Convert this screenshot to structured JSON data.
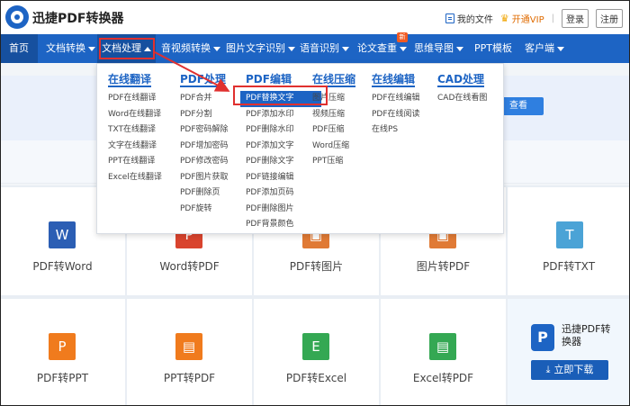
{
  "header": {
    "brand": "迅捷PDF转换器",
    "my_files": "我的文件",
    "vip": "开通VIP",
    "login": "登录",
    "register": "注册"
  },
  "nav": {
    "items": [
      "首页",
      "文档转换",
      "文档处理",
      "音视频转换",
      "图片文字识别",
      "语音识别",
      "论文查重",
      "思维导图",
      "PPT模板",
      "客户端"
    ],
    "badge": "新",
    "active_index": 2
  },
  "hero": {
    "button": "查看"
  },
  "dropdown": {
    "columns": [
      {
        "title": "在线翻译",
        "items": [
          "PDF在线翻译",
          "Word在线翻译",
          "TXT在线翻译",
          "文字在线翻译",
          "PPT在线翻译",
          "Excel在线翻译"
        ]
      },
      {
        "title": "PDF处理",
        "items": [
          "PDF合并",
          "PDF分割",
          "PDF密码解除",
          "PDF增加密码",
          "PDF修改密码",
          "PDF图片获取",
          "PDF删除页",
          "PDF旋转"
        ]
      },
      {
        "title": "PDF编辑",
        "items": [
          "PDF替换文字",
          "PDF添加水印",
          "PDF删除水印",
          "PDF添加文字",
          "PDF删除文字",
          "PDF链接编辑",
          "PDF添加页码",
          "PDF删除图片",
          "PDF背景颜色"
        ]
      },
      {
        "title": "在线压缩",
        "items": [
          "图片压缩",
          "视频压缩",
          "PDF压缩",
          "Word压缩",
          "PPT压缩"
        ]
      },
      {
        "title": "在线编辑",
        "items": [
          "PDF在线编辑",
          "PDF在线阅读",
          "在线PS"
        ]
      },
      {
        "title": "CAD处理",
        "items": [
          "CAD在线看图"
        ]
      }
    ],
    "selected": "PDF替换文字"
  },
  "tools": {
    "row1": [
      {
        "label": "PDF转Word",
        "icon": "W",
        "color": "#2b5eb4"
      },
      {
        "label": "Word转PDF",
        "icon": "P",
        "color": "#d9442e"
      },
      {
        "label": "PDF转图片",
        "icon": "▣",
        "color": "#e07a35"
      },
      {
        "label": "图片转PDF",
        "icon": "▣",
        "color": "#e07a35"
      },
      {
        "label": "PDF转TXT",
        "icon": "T",
        "color": "#4ba3d6"
      }
    ],
    "row2": [
      {
        "label": "PDF转PPT",
        "icon": "P",
        "color": "#f07b1d"
      },
      {
        "label": "PPT转PDF",
        "icon": "▤",
        "color": "#f07b1d"
      },
      {
        "label": "PDF转Excel",
        "icon": "E",
        "color": "#34a853"
      },
      {
        "label": "Excel转PDF",
        "icon": "▤",
        "color": "#34a853"
      }
    ]
  },
  "promo": {
    "name": "迅捷PDF转换器",
    "download": "立即下载"
  },
  "colors": {
    "primary": "#1d64c4",
    "highlight": "#e0302f",
    "accent": "#f05a23"
  }
}
